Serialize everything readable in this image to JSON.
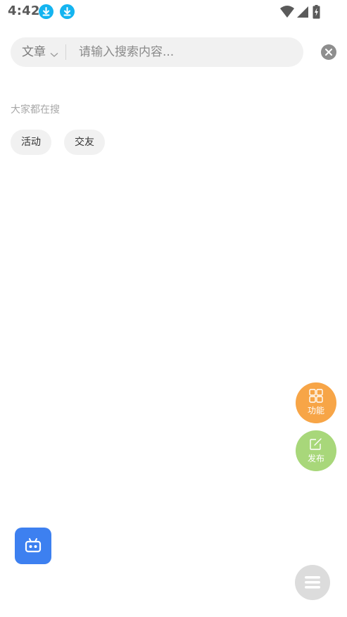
{
  "status_bar": {
    "time": "4:42",
    "notification_icons": [
      "download-icon",
      "download-icon"
    ],
    "system_icons": [
      "wifi-icon",
      "signal-icon",
      "battery-charging-icon"
    ]
  },
  "search": {
    "type_label": "文章",
    "placeholder": "请输入搜索内容...",
    "value": ""
  },
  "hot": {
    "title": "大家都在搜",
    "tags": [
      "活动",
      "交友"
    ]
  },
  "fabs": {
    "function_label": "功能",
    "post_label": "发布"
  },
  "colors": {
    "function_fab": "#f7a547",
    "post_fab": "#a8d77a",
    "bot_button": "#3d80f0",
    "download_icon": "#14b4f0",
    "menu_button": "#dcdcdc"
  }
}
